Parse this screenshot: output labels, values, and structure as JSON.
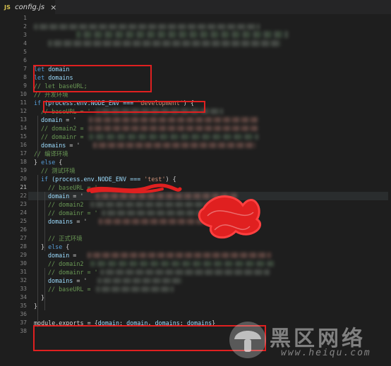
{
  "tab": {
    "language_badge": "JS",
    "title": "config.js",
    "close": "×"
  },
  "line_numbers": [
    "1",
    "2",
    "3",
    "4",
    "5",
    "6",
    "7",
    "8",
    "9",
    "10",
    "11",
    "12",
    "13",
    "14",
    "15",
    "16",
    "17",
    "18",
    "19",
    "20",
    "21",
    "22",
    "23",
    "24",
    "25",
    "26",
    "27",
    "28",
    "29",
    "30",
    "31",
    "32",
    "33",
    "34",
    "35",
    "36",
    "37",
    "38"
  ],
  "current_line": "21",
  "code": {
    "l7_kw": "let",
    "l7_var": "domain",
    "l8_kw": "let",
    "l8_var": "domains",
    "l9": "// let baseURL;",
    "l10": "// 开发环境",
    "l11_kw": "if",
    "l11_a": " (process.env.NODE_ENV === ",
    "l11_str": "'development'",
    "l11_b": ") {",
    "l12": "// baseURL = '",
    "l13_var": "domain",
    "l13_op": " = '",
    "l14": "// domain2 = ",
    "l15": "// domainr = ",
    "l16_var": "domains",
    "l16_op": " = '",
    "l17": "// 编译环境",
    "l18_a": "} ",
    "l18_kw": "else",
    "l18_b": " {",
    "l19": "// 测试环境",
    "l20_kw": "if",
    "l20_a": " (process.env.NODE_ENV === ",
    "l20_str": "'test'",
    "l20_b": ") {",
    "l21": "// baseURL = '",
    "l22_var": "domain",
    "l22_op": " = '",
    "l23": "// domain2",
    "l24": "// domainr = '",
    "l25_var": "domains",
    "l25_op": " = '",
    "l27": "// 正式环境",
    "l28_a": "} ",
    "l28_kw": "else",
    "l28_b": " {",
    "l29_var": "domain",
    "l29_op": " = ",
    "l30": "// domain2",
    "l31": "// domainr = '",
    "l32_var": "domains",
    "l32_op": " = '",
    "l33": "// baseURL = ",
    "l34": "}",
    "l35": "}",
    "l37_a": "module.exports = {",
    "l37_k1": "domain",
    "l37_c1": ": ",
    "l37_v1": "domain",
    "l37_sep": ", ",
    "l37_k2": "domains",
    "l37_c2": ": ",
    "l37_v2": "domains",
    "l37_b": "}"
  },
  "watermark": {
    "title": "黑区网络",
    "url": "www.heiqu.com"
  },
  "colors": {
    "keyword": "#569cd6",
    "variable": "#9cdcfe",
    "string": "#ce9178",
    "comment": "#6a9955",
    "annotation": "#e02020"
  }
}
